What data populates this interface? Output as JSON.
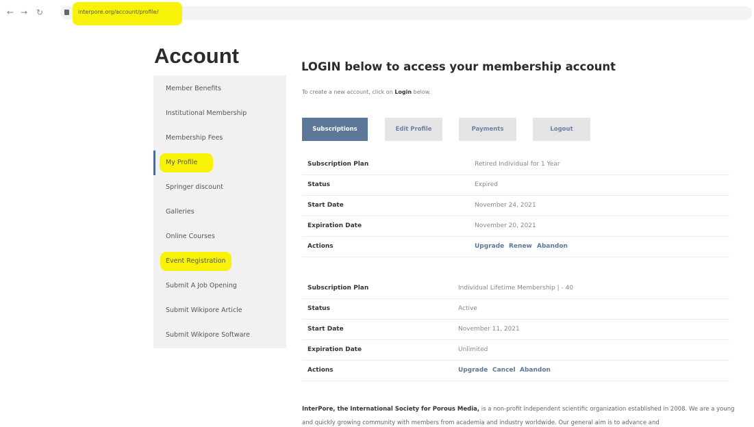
{
  "browser": {
    "back_glyph": "←",
    "forward_glyph": "→",
    "reload_glyph": "↻",
    "url": "interpore.org/account/profile/",
    "highlight_color": "#f7f207"
  },
  "page": {
    "title": "Account"
  },
  "sidebar": {
    "items": [
      {
        "label": "Member Benefits"
      },
      {
        "label": "Institutional Membership"
      },
      {
        "label": "Membership Fees"
      },
      {
        "label": "My Profile",
        "active": true,
        "highlighted": true
      },
      {
        "label": "Springer discount"
      },
      {
        "label": "Galleries"
      },
      {
        "label": "Online Courses"
      },
      {
        "label": "Event Registration",
        "highlighted": true
      },
      {
        "label": "Submit A Job Opening"
      },
      {
        "label": "Submit Wikipore Article"
      },
      {
        "label": "Submit Wikipore Software"
      }
    ]
  },
  "main": {
    "heading": "LOGIN below to access your membership account",
    "subtext_prefix": "To create a new account, click on ",
    "subtext_bold": "Login",
    "subtext_suffix": " below.",
    "tabs": [
      {
        "label": "Subscriptions",
        "active": true
      },
      {
        "label": "Edit Profile"
      },
      {
        "label": "Payments"
      },
      {
        "label": "Logout"
      }
    ],
    "subscriptions": [
      {
        "rows": [
          {
            "key": "Subscription Plan",
            "value": "Retired Individual for 1 Year"
          },
          {
            "key": "Status",
            "value": "Expired"
          },
          {
            "key": "Start Date",
            "value": "November 24, 2021"
          },
          {
            "key": "Expiration Date",
            "value": "November 20, 2021"
          }
        ],
        "actions_label": "Actions",
        "actions": [
          "Upgrade",
          "Renew",
          "Abandon"
        ]
      },
      {
        "rows": [
          {
            "key": "Subscription Plan",
            "value": "Individual Lifetime Membership | - 40"
          },
          {
            "key": "Status",
            "value": "Active"
          },
          {
            "key": "Start Date",
            "value": "November 11, 2021"
          },
          {
            "key": "Expiration Date",
            "value": "Unlimited"
          }
        ],
        "actions_label": "Actions",
        "actions": [
          "Upgrade",
          "Cancel",
          "Abandon"
        ]
      }
    ],
    "footer_bold": "InterPore, the International Society for Porous Media,",
    "footer_text": " is a non-profit independent scientific organization established in 2008. We are a young and quickly growing community with members from academia and industry worldwide. Our general aim is to advance and"
  },
  "colors": {
    "accent": "#5b7899",
    "sidebar_bg": "#f1f1f1",
    "tab_bg": "#e4e4e4"
  }
}
